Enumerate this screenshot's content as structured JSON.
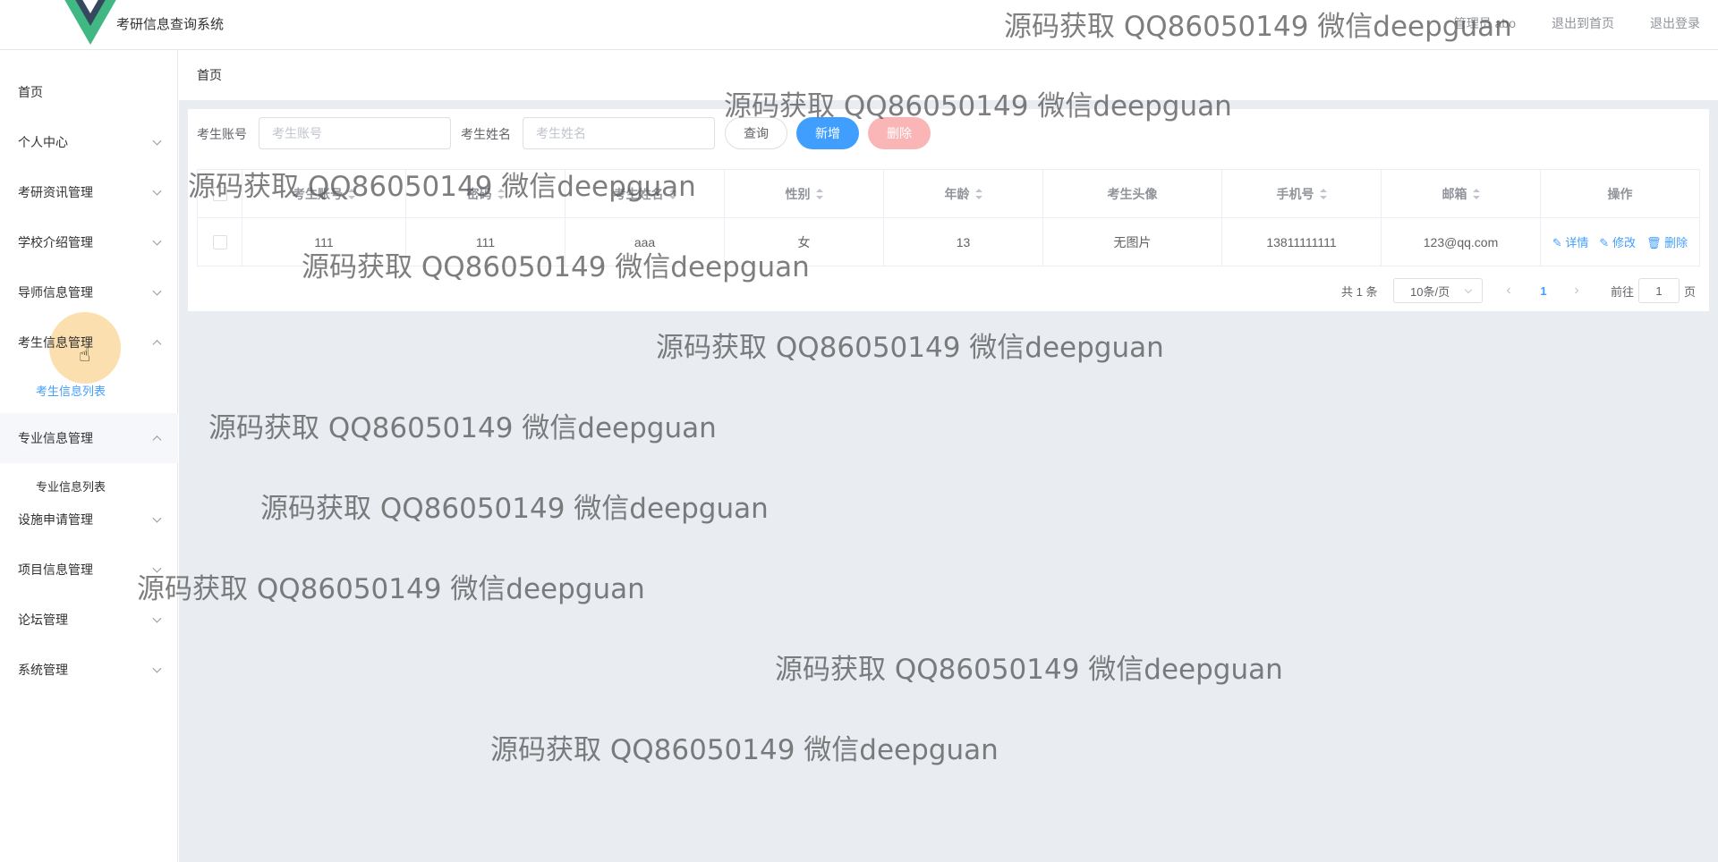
{
  "header": {
    "app_title": "考研信息查询系统",
    "user_label": "管理员 abo",
    "exit_to_home": "退出到首页",
    "logout": "退出登录"
  },
  "sidebar": {
    "items": [
      {
        "label": "首页"
      },
      {
        "label": "个人中心"
      },
      {
        "label": "考研资讯管理"
      },
      {
        "label": "学校介绍管理"
      },
      {
        "label": "导师信息管理"
      },
      {
        "label": "考生信息管理"
      },
      {
        "label": "专业信息管理"
      },
      {
        "label": "设施申请管理"
      },
      {
        "label": "项目信息管理"
      },
      {
        "label": "论坛管理"
      },
      {
        "label": "系统管理"
      }
    ],
    "subitems": {
      "student_list": "考生信息列表",
      "major_list": "专业信息列表"
    }
  },
  "breadcrumb": "首页",
  "search": {
    "account_label": "考生账号",
    "account_placeholder": "考生账号",
    "name_label": "考生姓名",
    "name_placeholder": "考生姓名",
    "query_button": "查询",
    "add_button": "新增",
    "delete_button": "删除"
  },
  "table": {
    "headers": [
      "考生账号",
      "密码",
      "考生姓名",
      "性别",
      "年龄",
      "考生头像",
      "手机号",
      "邮箱",
      "操作"
    ],
    "rows": [
      {
        "account": "111",
        "password": "111",
        "name": "aaa",
        "gender": "女",
        "age": "13",
        "avatar": "无图片",
        "phone": "13811111111",
        "email": "123@qq.com"
      }
    ],
    "actions": {
      "detail": "详情",
      "edit": "修改",
      "delete": "删除"
    }
  },
  "pagination": {
    "total": "共 1 条",
    "page_size": "10条/页",
    "current_page": "1",
    "goto_prefix": "前往",
    "goto_value": "1",
    "goto_suffix": "页"
  },
  "watermark": "源码获取 QQ86050149 微信deepguan",
  "colors": {
    "primary": "#409eff",
    "danger_disabled": "#fab6b6",
    "content_bg": "#e9edf2",
    "logo_green": "#41b883",
    "logo_dark": "#35495e"
  }
}
